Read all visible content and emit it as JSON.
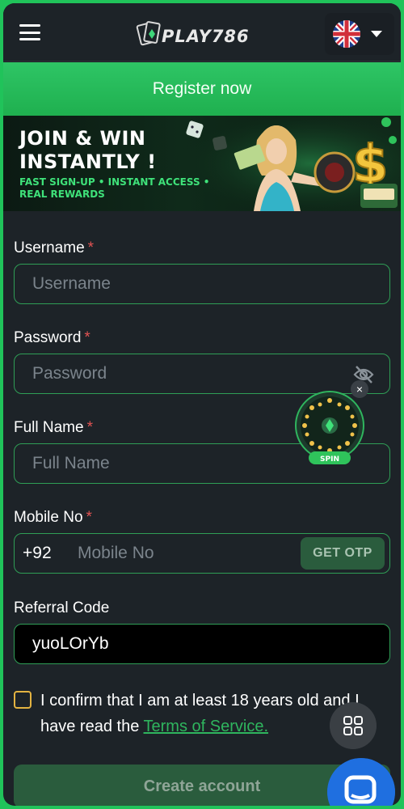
{
  "header": {
    "logo_text": "PLAY786",
    "language_icon": "uk-flag-icon"
  },
  "register_bar": {
    "label": "Register now"
  },
  "banner": {
    "title_line1": "JOIN & WIN",
    "title_line2": "INSTANTLY !",
    "subtitle": "FAST SIGN-UP • INSTANT ACCESS • REAL REWARDS"
  },
  "form": {
    "username": {
      "label": "Username",
      "required_mark": "*",
      "placeholder": "Username"
    },
    "password": {
      "label": "Password",
      "required_mark": "*",
      "placeholder": "Password",
      "toggle_icon": "eye-off-icon"
    },
    "full_name": {
      "label": "Full Name",
      "required_mark": "*",
      "placeholder": "Full Name"
    },
    "mobile": {
      "label": "Mobile No",
      "required_mark": "*",
      "prefix": "+92",
      "placeholder": "Mobile No",
      "otp_label": "GET OTP"
    },
    "referral": {
      "label": "Referral Code",
      "value": "yuoLOrYb"
    },
    "confirm_text": "I confirm that I am at least 18 years old and I have read the ",
    "terms_link": "Terms of Service.",
    "submit_label": "Create account"
  },
  "floating": {
    "spin_label": "SPIN",
    "close_glyph": "×",
    "apps_icon": "grid-icon",
    "chat_icon": "chat-icon"
  },
  "colors": {
    "accent_green": "#20c35a",
    "background": "#1d2328",
    "required": "#e25353",
    "checkbox_border": "#e3b341",
    "chat_blue": "#1f6fe0"
  }
}
